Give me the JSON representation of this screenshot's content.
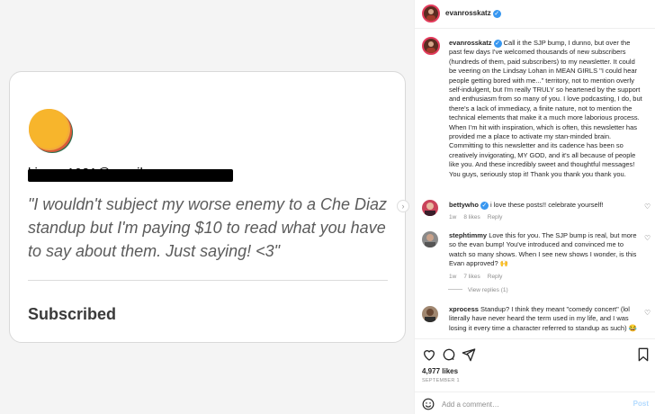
{
  "media": {
    "email_redacted": "l.jones1021@gmail.com",
    "quote": "\"I wouldn't subject my worse enemy to a Che Diaz standup but I'm paying $10 to read what you have to say about them. Just saying! <3\"",
    "status": "Subscribed",
    "next_icon": "chevron-right-icon"
  },
  "header": {
    "username": "evanrosskatz"
  },
  "caption": {
    "username": "evanrosskatz",
    "text": "Call it the SJP bump, I dunno, but over the past few days I've welcomed thousands of new subscribers (hundreds of them, paid subscribers) to my newsletter. It could be veering on the Lindsay Lohan in MEAN GIRLS \"I could hear people getting bored with me...\" territory, not to mention overly self-indulgent, but I'm really TRULY so heartened by the support and enthusiasm from so many of you. I love podcasting, I do, but there's a lack of immediacy, a finite nature, not to mention the technical elements that make it a much more laborious process. When I'm hit with inspiration, which is often, this newsletter has provided me a place to activate my stan-minded brain. Committing to this newsletter and its cadence has been so creatively invigorating, MY GOD, and it's all because of people like you. And these incredibly sweet and thoughtful messages! You guys, seriously stop it! Thank you thank you thank you."
  },
  "comments": [
    {
      "username": "bettywho",
      "verified": true,
      "text": "i love these posts!! celebrate yourself!",
      "age": "1w",
      "likes": "8 likes",
      "reply": "Reply"
    },
    {
      "username": "stephtimmy",
      "verified": false,
      "text": "Love this for you. The SJP bump is real, but more so the evan bump! You've introduced and convinced me to watch so many shows. When I see new shows I wonder, is this Evan approved? 🙌",
      "age": "1w",
      "likes": "7 likes",
      "reply": "Reply"
    },
    {
      "username": "xprocess",
      "verified": false,
      "text": "Standup? I think they meant \"comedy concert\" (lol literally have never heard the term used in my life, and I was losing it every time a character referred to standup as such) 😂",
      "age": "",
      "likes": "",
      "reply": ""
    }
  ],
  "view_replies": "View replies (1)",
  "actions": {
    "icons": [
      "heart-icon",
      "comment-icon",
      "share-icon",
      "bookmark-icon"
    ]
  },
  "likes": "4,977 likes",
  "date": "SEPTEMBER 1",
  "add_comment": {
    "placeholder": "Add a comment…",
    "post_label": "Post"
  },
  "colors": {
    "verified": "#3897f0",
    "ring": "#e33b5c",
    "post_disabled": "#b3dbff",
    "muted": "#8e8e8e"
  }
}
